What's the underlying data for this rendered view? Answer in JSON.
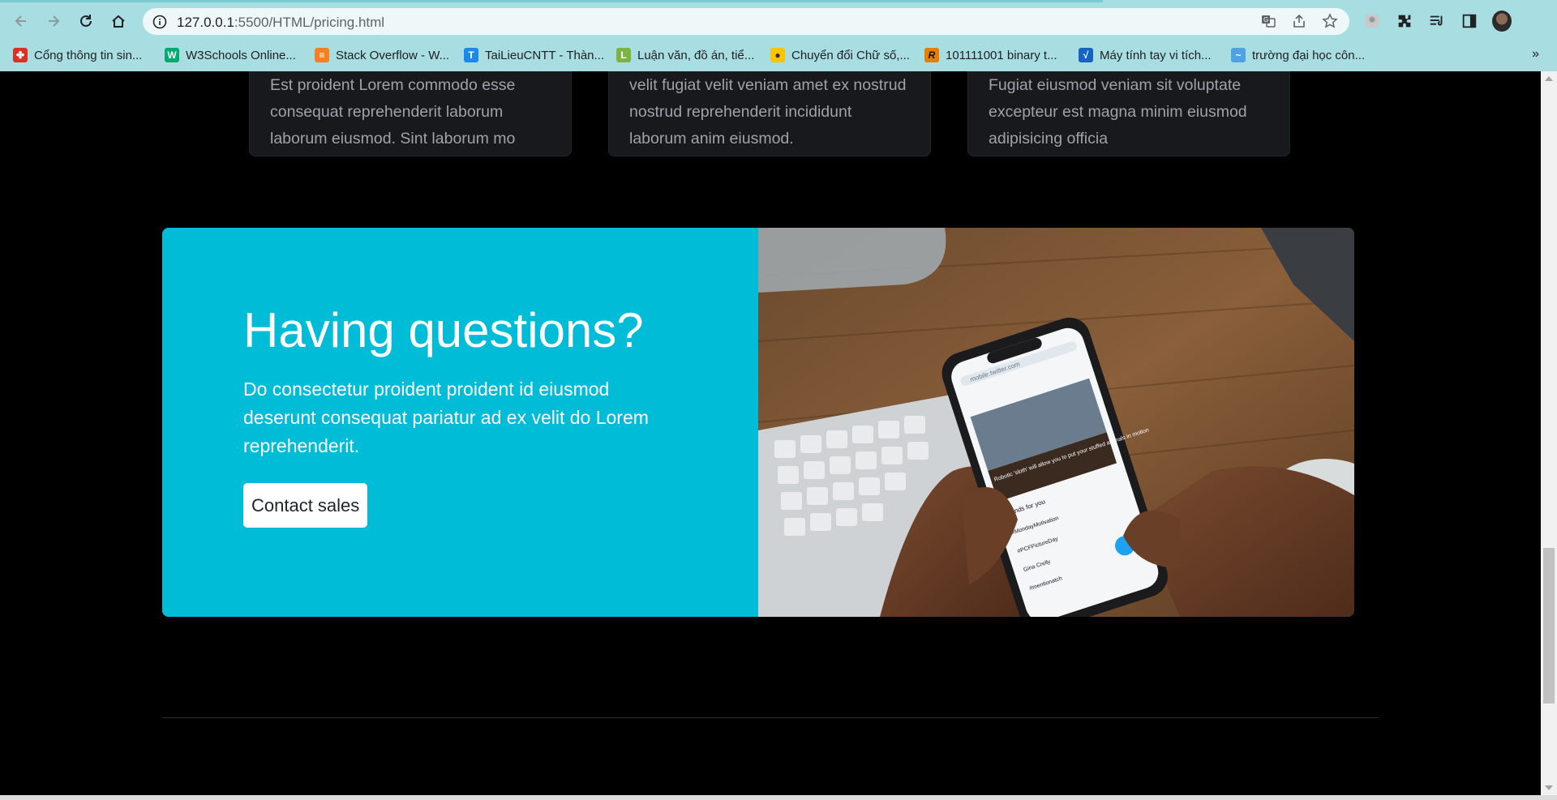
{
  "browser": {
    "url_host": "127.0.0.1",
    "url_path": ":5500/HTML/pricing.html",
    "bookmarks": [
      {
        "label": "Cổng thông tin sin...",
        "color": "#d93025",
        "glyph": "✤"
      },
      {
        "label": "W3Schools Online...",
        "color": "#04aa6d",
        "glyph": "W"
      },
      {
        "label": "Stack Overflow - W...",
        "color": "#f48024",
        "glyph": "≡"
      },
      {
        "label": "TaiLieuCNTT - Thàn...",
        "color": "#1e88e5",
        "glyph": "T"
      },
      {
        "label": "Luận văn, đồ án, tiể...",
        "color": "#7cb342",
        "glyph": "L"
      },
      {
        "label": "Chuyển đổi Chữ số,...",
        "color": "#f9c400",
        "glyph": "●"
      },
      {
        "label": "101111001 binary t...",
        "color": "#e67e00",
        "glyph": "R"
      },
      {
        "label": "Máy tính tay vi tích...",
        "color": "#1565c0",
        "glyph": "√"
      },
      {
        "label": "trường đại học côn...",
        "color": "#4fa3e0",
        "glyph": "~"
      }
    ]
  },
  "cards": [
    {
      "text": "Est proident Lorem commodo esse consequat reprehenderit laborum laborum eiusmod. Sint laborum mo"
    },
    {
      "text": "velit fugiat velit veniam amet ex nostrud nostrud reprehenderit incididunt laborum anim eiusmod."
    },
    {
      "text": "Fugiat eiusmod veniam sit voluptate excepteur est magna minim eiusmod adipisicing officia"
    }
  ],
  "cta": {
    "title": "Having questions?",
    "lead": "Do consectetur proident proident id eiusmod deserunt consequat pariatur ad ex velit do Lorem reprehenderit.",
    "button": "Contact sales"
  },
  "phone_screen": {
    "url": "mobile.twitter.com",
    "headline": "Robotic 'sloth' will allow you to put your stuffed animals in motion",
    "trends_label": "Trends for you",
    "trends": [
      "#MondayMotivation",
      "#PCFPictureDay",
      "Gina Crelly",
      "#mentionatch"
    ]
  },
  "colors": {
    "accent": "#00bcd6",
    "page_bg": "#000000",
    "card_bg": "#17191d"
  },
  "icons": [
    "back-icon",
    "forward-icon",
    "reload-icon",
    "home-icon",
    "info-icon",
    "translate-icon",
    "share-icon",
    "star-icon",
    "extensions-icon",
    "reading-list-icon",
    "side-panel-icon"
  ]
}
